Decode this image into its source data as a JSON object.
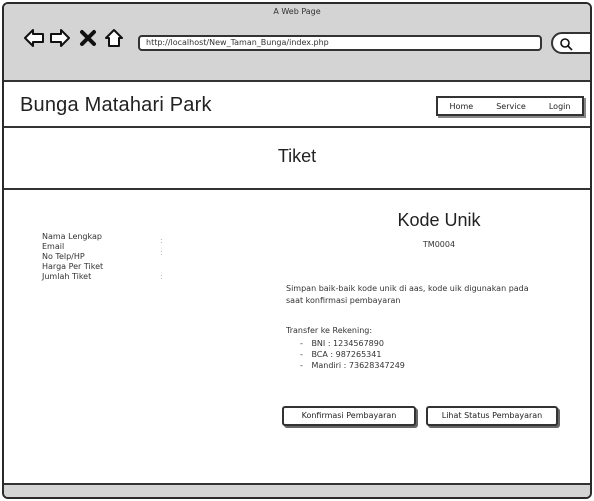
{
  "browser": {
    "title": "A Web Page",
    "url": "http://localhost/New_Taman_Bunga/index.php"
  },
  "nav_icons": [
    "back-arrow-icon",
    "forward-arrow-icon",
    "close-icon",
    "home-icon"
  ],
  "site": {
    "brand": "Bunga Matahari Park",
    "nav": [
      "Home",
      "Service",
      "Login"
    ]
  },
  "page": {
    "title": "Tiket"
  },
  "form": {
    "labels": [
      "Nama Lengkap",
      "Email",
      "No Telp/HP",
      "Harga Per Tiket",
      "Jumlah Tiket"
    ]
  },
  "kode": {
    "title": "Kode Unik",
    "value": "TM0004"
  },
  "notice": "Simpan baik-baik kode unik di aas, kode uik digunakan pada saat konfirmasi pembayaran",
  "transfer": {
    "title": "Transfer ke Rekening:",
    "banks": [
      "BNI : 1234567890",
      "BCA : 987265341",
      "Mandiri : 73628347249"
    ]
  },
  "buttons": {
    "confirm": "Konfirmasi Pembayaran",
    "status": "Lihat Status Pembayaran"
  }
}
